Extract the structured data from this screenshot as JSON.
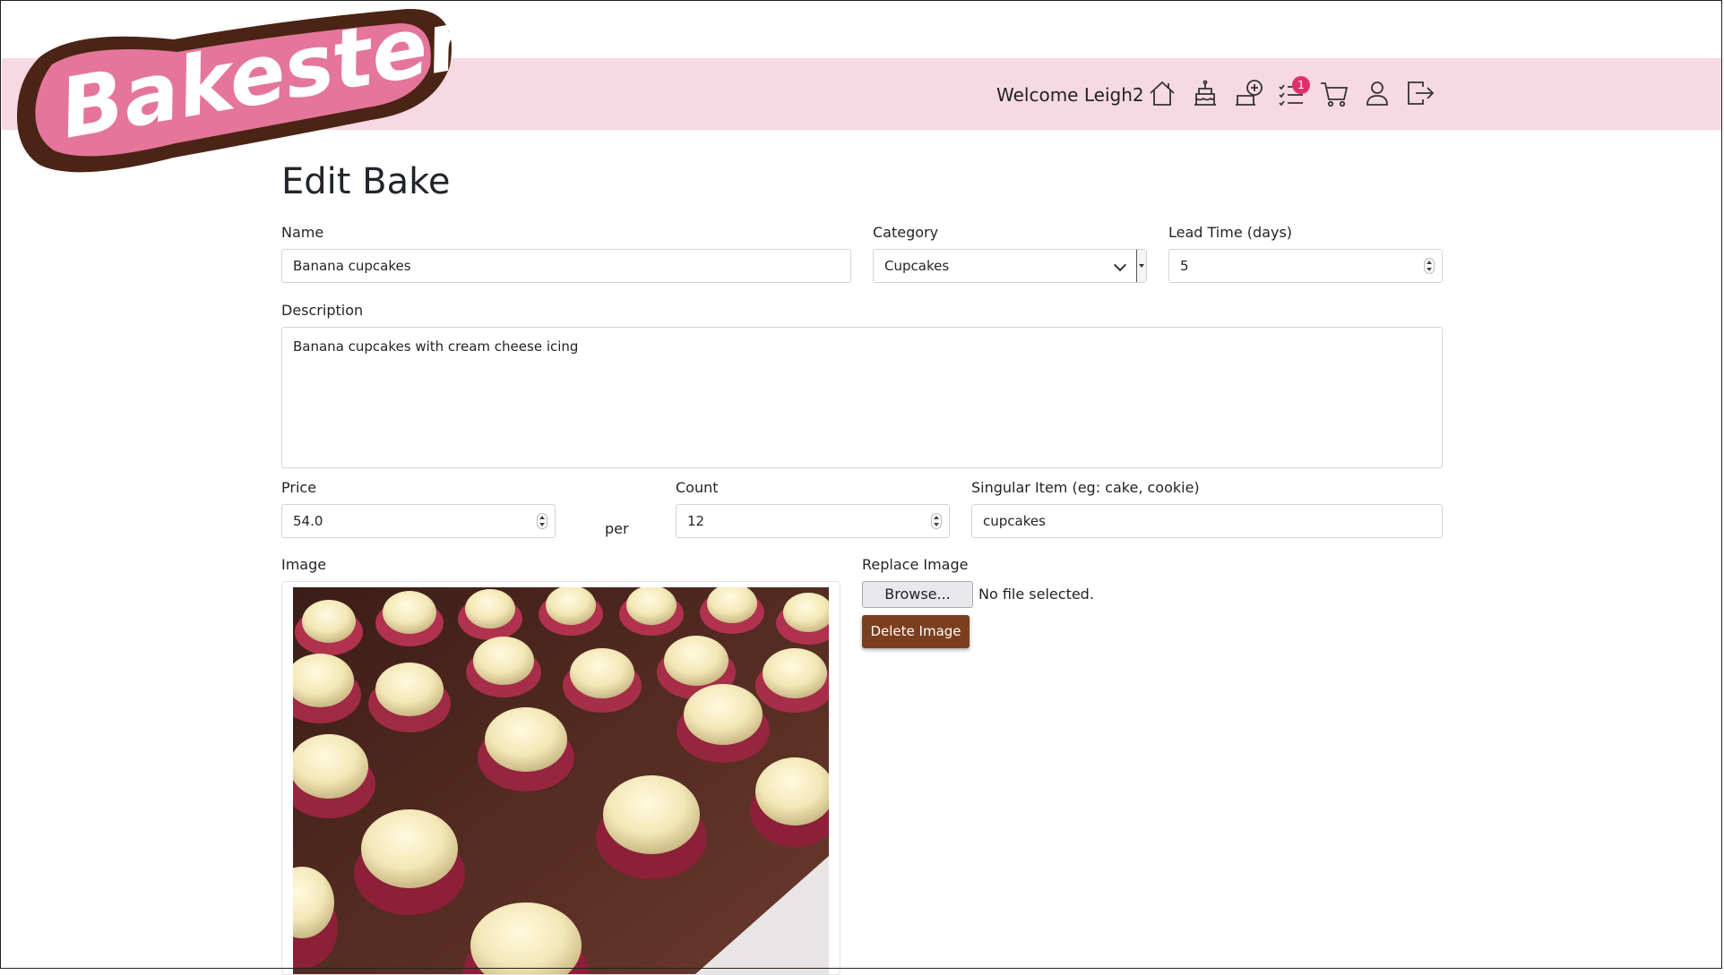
{
  "header": {
    "logo_text": "Bakester",
    "welcome": "Welcome Leigh2",
    "cart_badge": "1",
    "icons": [
      "home-icon",
      "cake-icon",
      "add-bake-icon",
      "orders-icon",
      "cart-icon",
      "user-icon",
      "logout-icon"
    ]
  },
  "page": {
    "title": "Edit Bake"
  },
  "form": {
    "name_label": "Name",
    "name_value": "Banana cupcakes",
    "category_label": "Category",
    "category_value": "Cupcakes",
    "lead_time_label": "Lead Time (days)",
    "lead_time_value": "5",
    "description_label": "Description",
    "description_value": "Banana cupcakes with cream cheese icing",
    "price_label": "Price",
    "price_value": "54.0",
    "per_text": "per",
    "count_label": "Count",
    "count_value": "12",
    "singular_label": "Singular Item (eg: cake, cookie)",
    "singular_value": "cupcakes",
    "image_label": "Image",
    "replace_label": "Replace Image",
    "browse_label": "Browse...",
    "no_file_text": "No file selected.",
    "delete_label": "Delete Image"
  },
  "colors": {
    "nav_band": "#f7d9e3",
    "logo_pink": "#e5759b",
    "logo_brown": "#4a2414",
    "delete_button": "#7b3f1f",
    "badge": "#e0306a"
  }
}
